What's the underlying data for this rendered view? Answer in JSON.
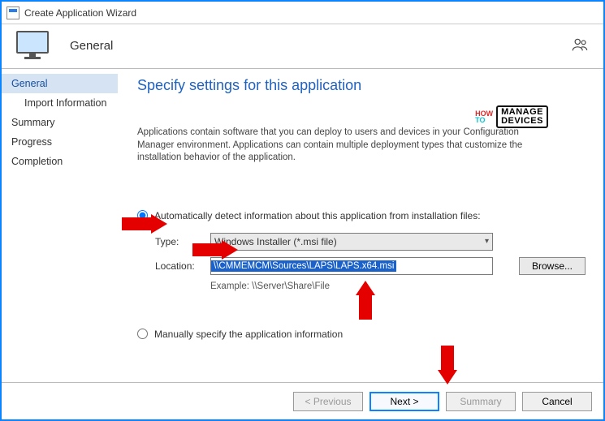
{
  "window": {
    "title": "Create Application Wizard",
    "section": "General"
  },
  "sidebar": {
    "items": [
      {
        "label": "General",
        "active": true
      },
      {
        "label": "Import Information",
        "indent": true
      },
      {
        "label": "Summary"
      },
      {
        "label": "Progress"
      },
      {
        "label": "Completion"
      }
    ]
  },
  "main": {
    "title": "Specify settings for this application",
    "description": "Applications contain software that you can deploy to users and devices in your Configuration Manager environment. Applications can contain multiple deployment types that customize the installation behavior of the application.",
    "auto_radio_label": "Automatically detect information about this application from installation files:",
    "manual_radio_label": "Manually specify the application information",
    "selected_option": "auto",
    "type_label": "Type:",
    "type_value": "Windows Installer (*.msi file)",
    "location_label": "Location:",
    "location_value": "\\\\CMMEMCM\\Sources\\LAPS\\LAPS.x64.msi",
    "browse_label": "Browse...",
    "example_label": "Example: \\\\Server\\Share\\File"
  },
  "footer": {
    "previous": "< Previous",
    "next": "Next >",
    "summary": "Summary",
    "cancel": "Cancel"
  },
  "watermark": {
    "how": "HOW",
    "to": "TO",
    "manage": "MANAGE",
    "devices": "DEVICES"
  }
}
